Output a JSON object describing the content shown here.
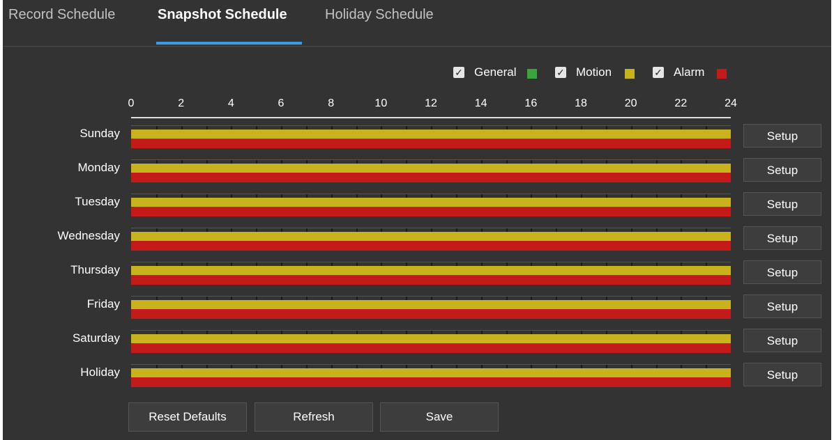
{
  "tabs": [
    {
      "label": "Record Schedule",
      "active": false
    },
    {
      "label": "Snapshot Schedule",
      "active": true
    },
    {
      "label": "Holiday Schedule",
      "active": false
    }
  ],
  "legend": [
    {
      "label": "General",
      "checked": true,
      "color": "#3aa53a"
    },
    {
      "label": "Motion",
      "checked": true,
      "color": "#c9b31c"
    },
    {
      "label": "Alarm",
      "checked": true,
      "color": "#c41a1a"
    }
  ],
  "hour_labels": [
    "0",
    "2",
    "4",
    "6",
    "8",
    "10",
    "12",
    "14",
    "16",
    "18",
    "20",
    "22",
    "24"
  ],
  "days": [
    {
      "label": "Sunday",
      "setup": "Setup"
    },
    {
      "label": "Monday",
      "setup": "Setup"
    },
    {
      "label": "Tuesday",
      "setup": "Setup"
    },
    {
      "label": "Wednesday",
      "setup": "Setup"
    },
    {
      "label": "Thursday",
      "setup": "Setup"
    },
    {
      "label": "Friday",
      "setup": "Setup"
    },
    {
      "label": "Saturday",
      "setup": "Setup"
    },
    {
      "label": "Holiday",
      "setup": "Setup"
    }
  ],
  "buttons": {
    "reset": "Reset Defaults",
    "refresh": "Refresh",
    "save": "Save"
  }
}
